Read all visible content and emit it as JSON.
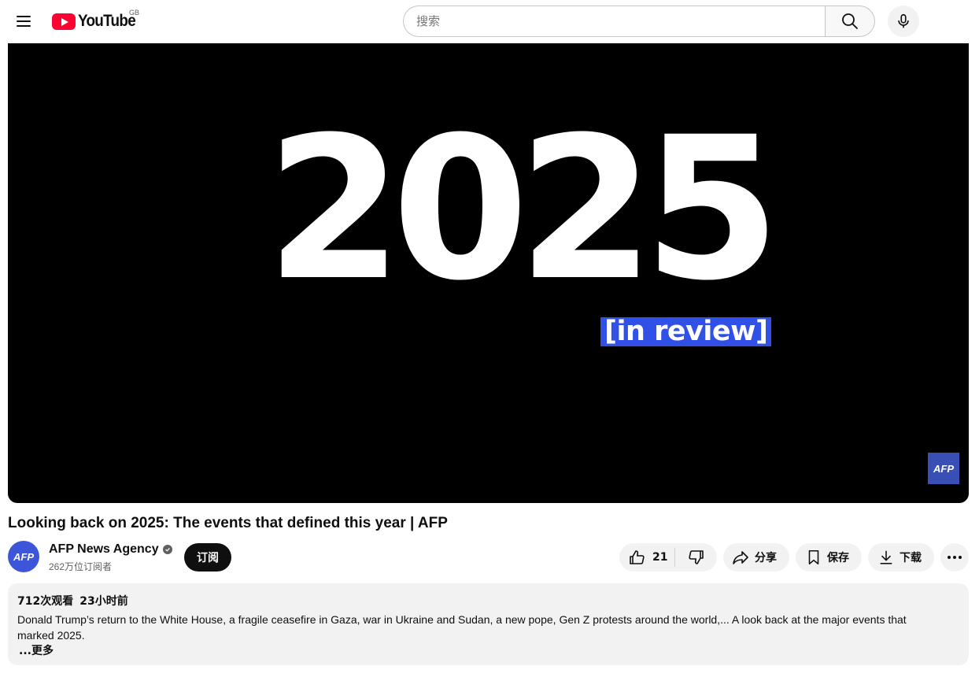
{
  "masthead": {
    "logo_text": "YouTube",
    "region": "GB",
    "search_placeholder": "搜索",
    "icons": {
      "menu": "hamburger-menu-icon",
      "search": "search-icon",
      "mic": "microphone-icon"
    }
  },
  "player": {
    "frame_title": "2025",
    "frame_subtitle": "[in review]",
    "watermark": "AFP",
    "colors": {
      "background": "#000000",
      "subtitle_bg": "#3050e8",
      "watermark_bg": "#3a4fb5"
    }
  },
  "video": {
    "title": "Looking back on 2025: The events that defined this year | AFP"
  },
  "owner": {
    "avatar_text": "AFP",
    "channel_name": "AFP News Agency",
    "subscribers": "262万位订阅者",
    "subscribe_label": "订阅"
  },
  "actions": {
    "like_count": "21",
    "share_label": "分享",
    "save_label": "保存",
    "download_label": "下载"
  },
  "description": {
    "views": "712次观看",
    "time_ago": "23小时前",
    "text": "Donald Trump’s return to the White House, a fragile ceasefire in Gaza, war in Ukraine and Sudan, a new pope, Gen Z protests around the world,... A look back at the major events that marked 2025.",
    "more_label": "...更多"
  }
}
